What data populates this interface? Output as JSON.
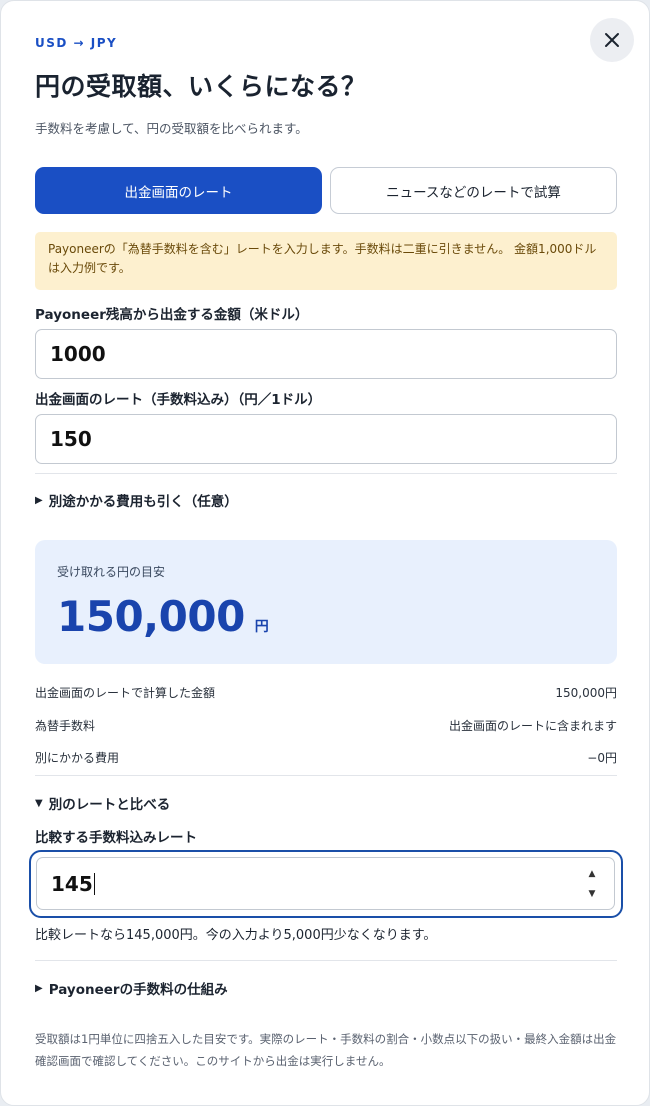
{
  "header": {
    "eyebrow": "USD → JPY",
    "title": "円の受取額、いくらになる？",
    "subtitle": "手数料を考慮して、円の受取額を比べられます。"
  },
  "tabs": [
    {
      "label": "出金画面のレート",
      "active": true
    },
    {
      "label": "ニュースなどのレートで試算",
      "active": false
    }
  ],
  "notice": {
    "text": "Payoneerの「為替手数料を含む」レートを入力します。手数料は二重に引きません。 金額1,000ドルは入力例です。"
  },
  "amount_field": {
    "label": "Payoneer残高から出金する金額（米ドル）",
    "value": "1000"
  },
  "rate_field": {
    "label": "出金画面のレート（手数料込み）（円／1ドル）",
    "value": "150"
  },
  "extra_costs_toggle": {
    "label": "別途かかる費用も引く（任意）",
    "expanded": false
  },
  "result": {
    "label": "受け取れる円の目安",
    "value": "150,000",
    "unit": "円"
  },
  "breakdown": [
    {
      "label": "出金画面のレートで計算した金額",
      "value": "150,000円"
    },
    {
      "label": "為替手数料",
      "value": "出金画面のレートに含まれます"
    },
    {
      "label": "別にかかる費用",
      "value": "−0円"
    }
  ],
  "compare_toggle": {
    "label": "別のレートと比べる",
    "expanded": true
  },
  "compare_field": {
    "label": "比較する手数料込みレート",
    "value": "145",
    "note": "比較レートなら145,000円。今の入力より5,000円少なくなります。"
  },
  "fees_toggle": {
    "label": "Payoneerの手数料の仕組み",
    "expanded": false
  },
  "footnote": "受取額は1円単位に四捨五入した目安です。実際のレート・手数料の割合・小数点以下の扱い・最終入金額は出金確認画面で確認してください。このサイトから出金は実行しません。",
  "colors": {
    "accent": "#1a4fc4",
    "result_bg": "#e8f0fd",
    "notice_bg": "#fdf0cf",
    "focus_ring": "#1a4fa8"
  },
  "icons": {
    "close": "close-icon",
    "collapsed": "triangle-right-icon",
    "expanded": "triangle-down-icon"
  }
}
